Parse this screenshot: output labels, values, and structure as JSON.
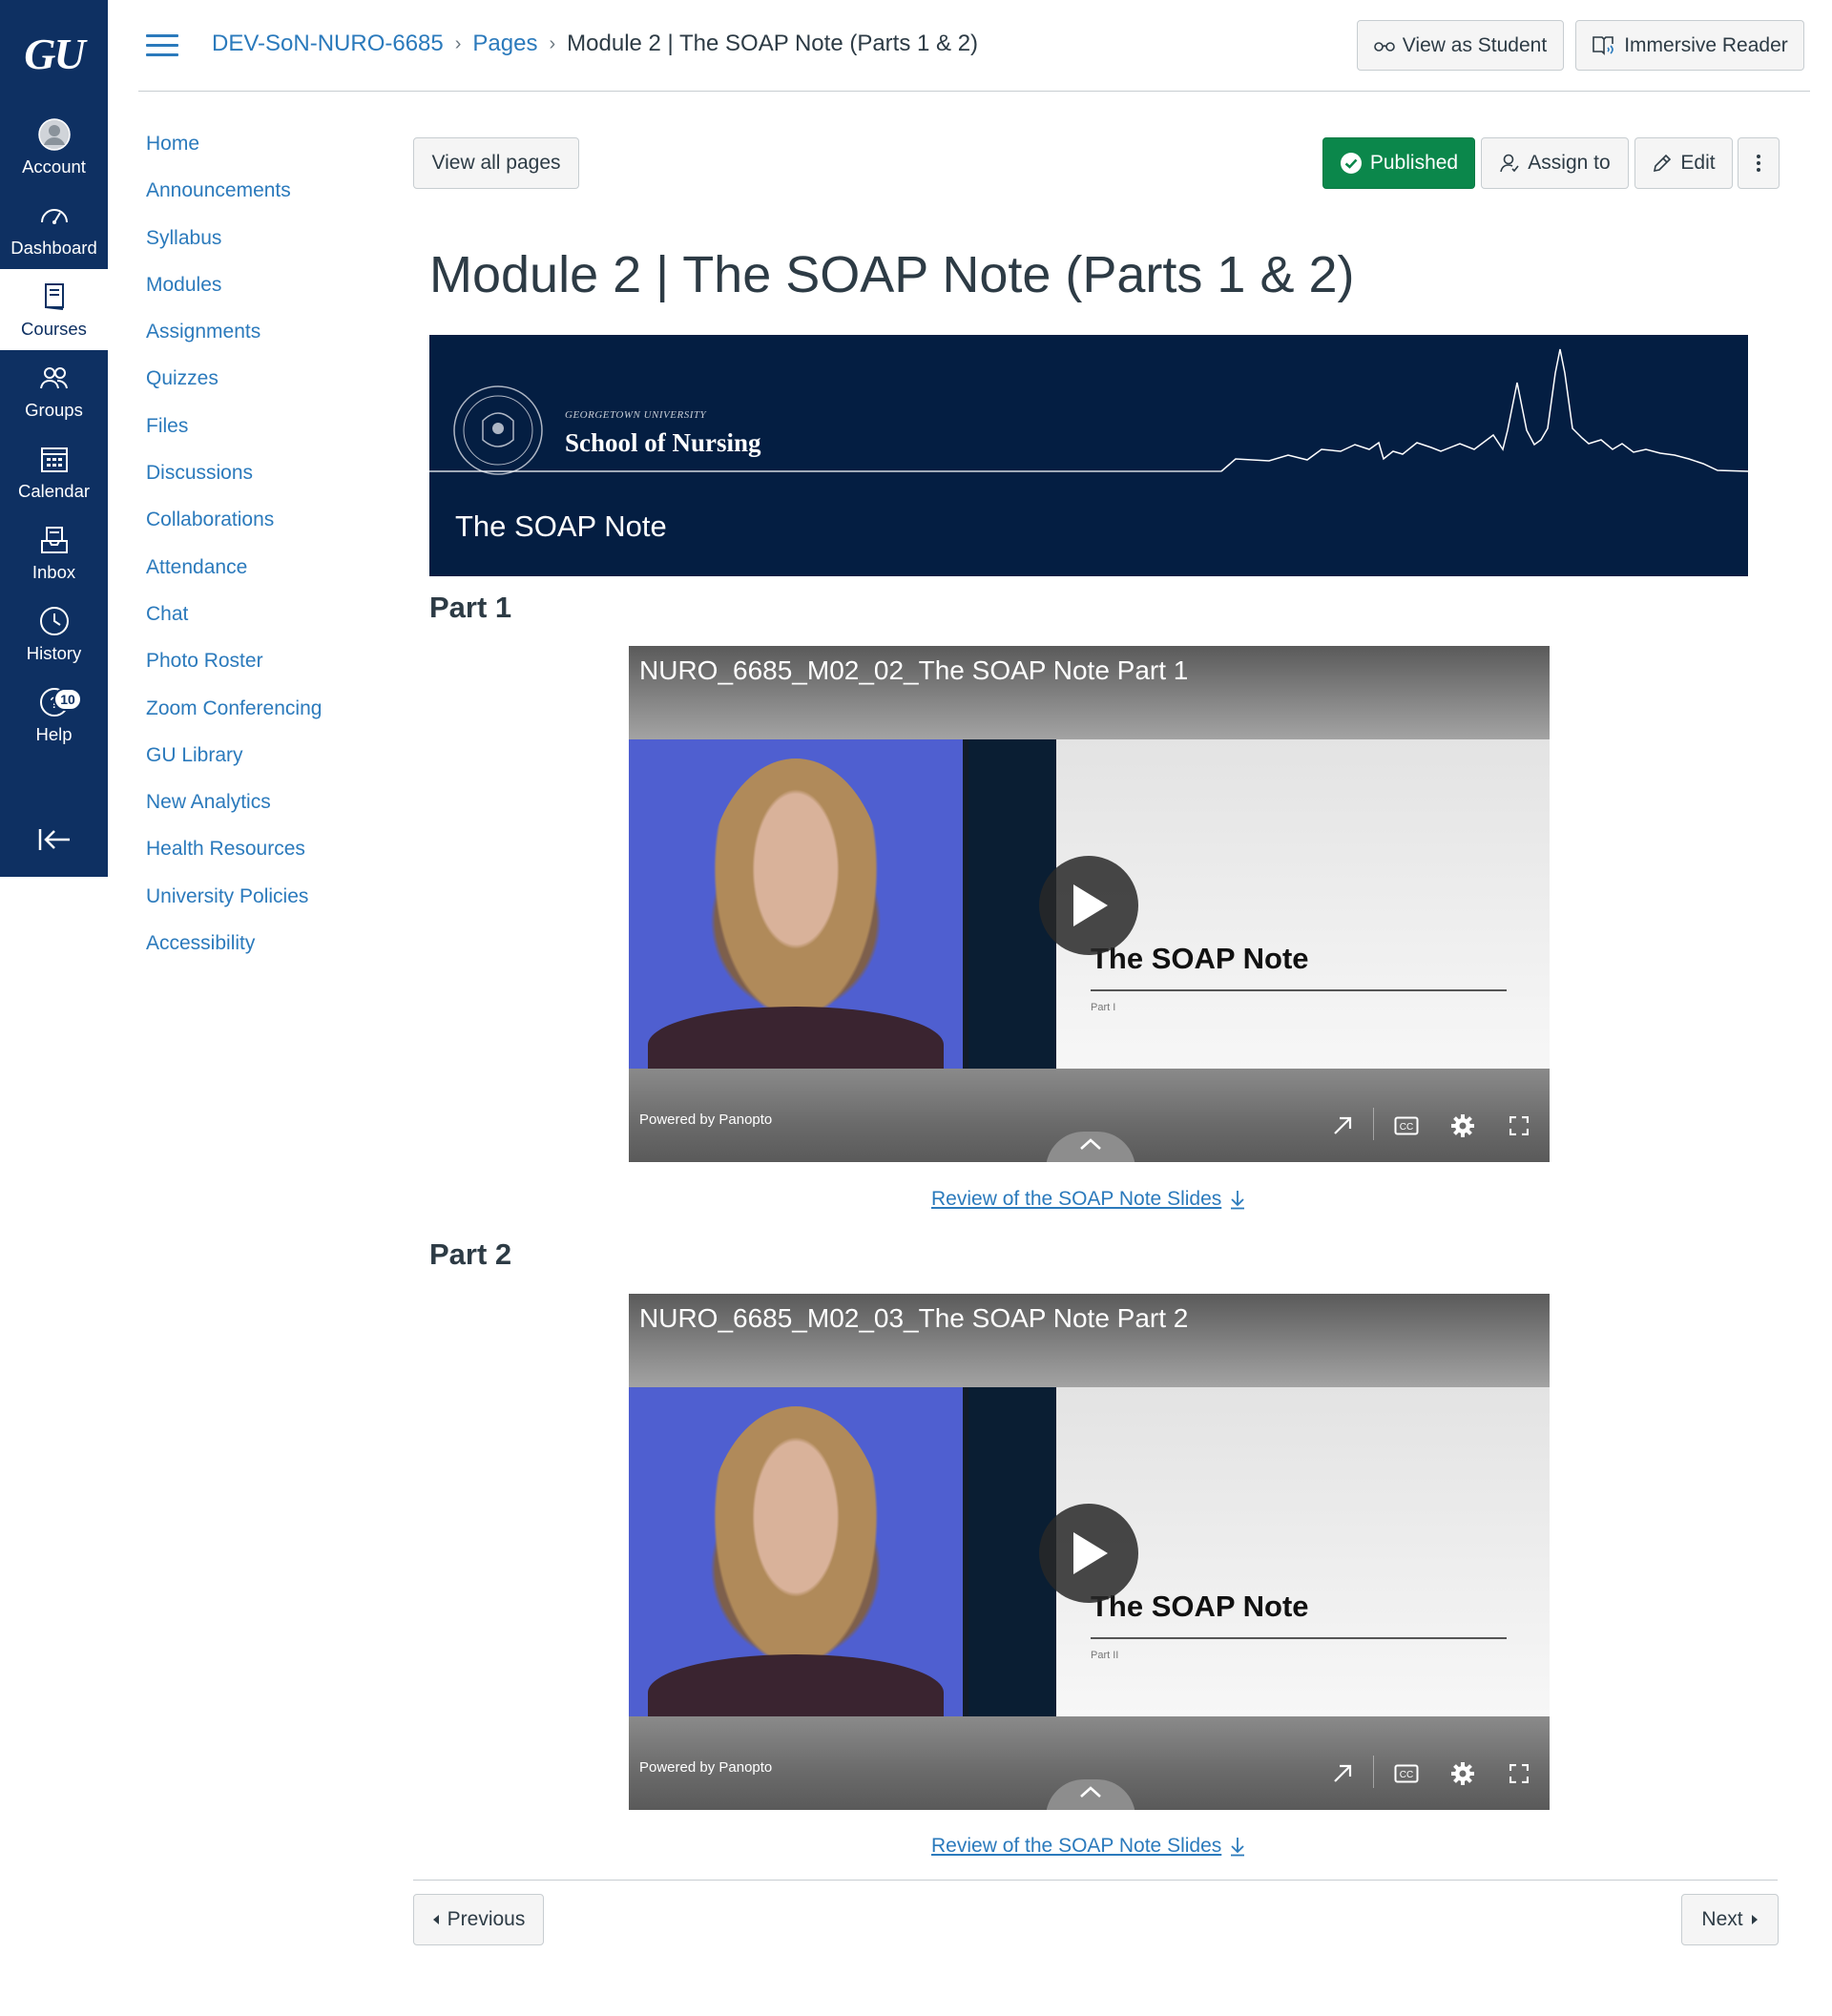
{
  "global_nav": {
    "logo": "GU",
    "items": [
      {
        "label": "Account",
        "icon": "account-icon"
      },
      {
        "label": "Dashboard",
        "icon": "dashboard-icon"
      },
      {
        "label": "Courses",
        "icon": "courses-icon"
      },
      {
        "label": "Groups",
        "icon": "groups-icon"
      },
      {
        "label": "Calendar",
        "icon": "calendar-icon"
      },
      {
        "label": "Inbox",
        "icon": "inbox-icon"
      },
      {
        "label": "History",
        "icon": "history-icon"
      },
      {
        "label": "Help",
        "icon": "help-icon",
        "badge": "10"
      }
    ],
    "active": "Courses"
  },
  "breadcrumb": {
    "course": "DEV-SoN-NURO-6685",
    "section": "Pages",
    "current": "Module 2 | The SOAP Note (Parts 1 & 2)"
  },
  "header_buttons": {
    "view_as_student": "View as Student",
    "immersive_reader": "Immersive Reader"
  },
  "course_nav": [
    "Home",
    "Announcements",
    "Syllabus",
    "Modules",
    "Assignments",
    "Quizzes",
    "Files",
    "Discussions",
    "Collaborations",
    "Attendance",
    "Chat",
    "Photo Roster",
    "Zoom Conferencing",
    "GU Library",
    "New Analytics",
    "Health Resources",
    "University Policies",
    "Accessibility"
  ],
  "toolbar": {
    "view_all_pages": "View all pages",
    "published": "Published",
    "assign_to": "Assign to",
    "edit": "Edit"
  },
  "page_title": "Module 2 | The SOAP Note (Parts 1 & 2)",
  "banner": {
    "university": "GEORGETOWN UNIVERSITY",
    "school": "School of Nursing",
    "heading": "The SOAP Note"
  },
  "parts": [
    {
      "title": "Part 1",
      "video_title": "NURO_6685_M02_02_The SOAP Note Part 1",
      "slide_title": "The SOAP Note",
      "slide_sub": "Part I",
      "powered_by": "Powered by Panopto",
      "link": "Review of the SOAP Note Slides"
    },
    {
      "title": "Part 2",
      "video_title": "NURO_6685_M02_03_The SOAP Note Part 2",
      "slide_title": "The SOAP Note",
      "slide_sub": "Part II",
      "powered_by": "Powered by Panopto",
      "link": "Review of the SOAP Note Slides"
    }
  ],
  "pagination": {
    "previous": "Previous",
    "next": "Next"
  },
  "colors": {
    "nav_bg": "#0e3062",
    "link": "#2b7abc",
    "published": "#0b874b",
    "banner_bg": "#041e42"
  }
}
